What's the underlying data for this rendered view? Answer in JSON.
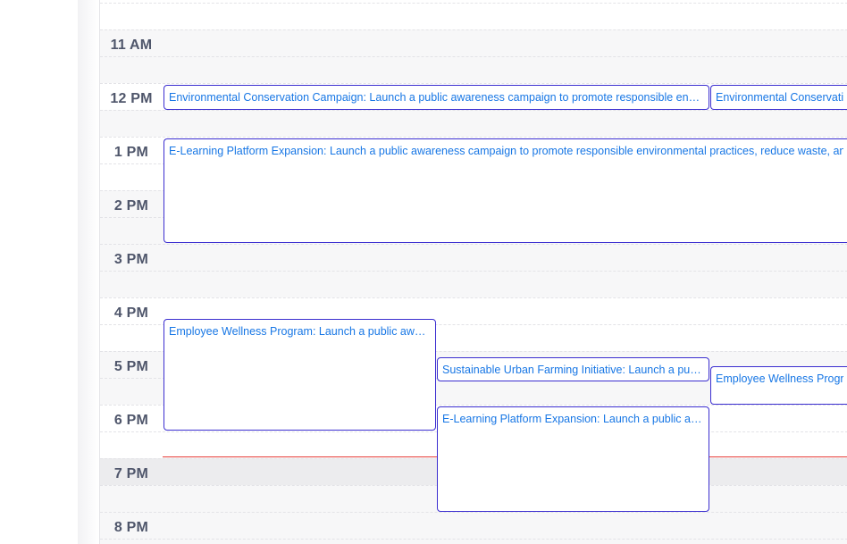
{
  "calendar": {
    "hour_labels": [
      "11 AM",
      "12 PM",
      "1 PM",
      "2 PM",
      "3 PM",
      "4 PM",
      "5 PM",
      "6 PM",
      "7 PM",
      "8 PM"
    ],
    "colors": {
      "event_border": "#3b2ed0",
      "event_text": "#1877e5",
      "now_line": "#e53935",
      "hour_label": "#4f566b"
    },
    "events": [
      {
        "title": "Environmental Conservation Campaign: Launch a public awareness campaign to promote responsible environmental practices, reduce waste, and encourage sustainable habits"
      },
      {
        "title": "Environmental Conservation Campaign: Launch a public awareness campaign to promote responsible environmental practices"
      },
      {
        "title": "E-Learning Platform Expansion: Launch a public awareness campaign to promote responsible environmental practices, reduce waste, and encourage sustainable habits"
      },
      {
        "title": "Employee Wellness Program: Launch a public awareness campaign to promote responsible environmental practices"
      },
      {
        "title": "Sustainable Urban Farming Initiative: Launch a public awareness campaign to promote responsible environmental practices"
      },
      {
        "title": "Employee Wellness Program: Launch a public awareness campaign"
      },
      {
        "title": "E-Learning Platform Expansion: Launch a public awareness campaign to promote responsible environmental practices"
      }
    ]
  }
}
